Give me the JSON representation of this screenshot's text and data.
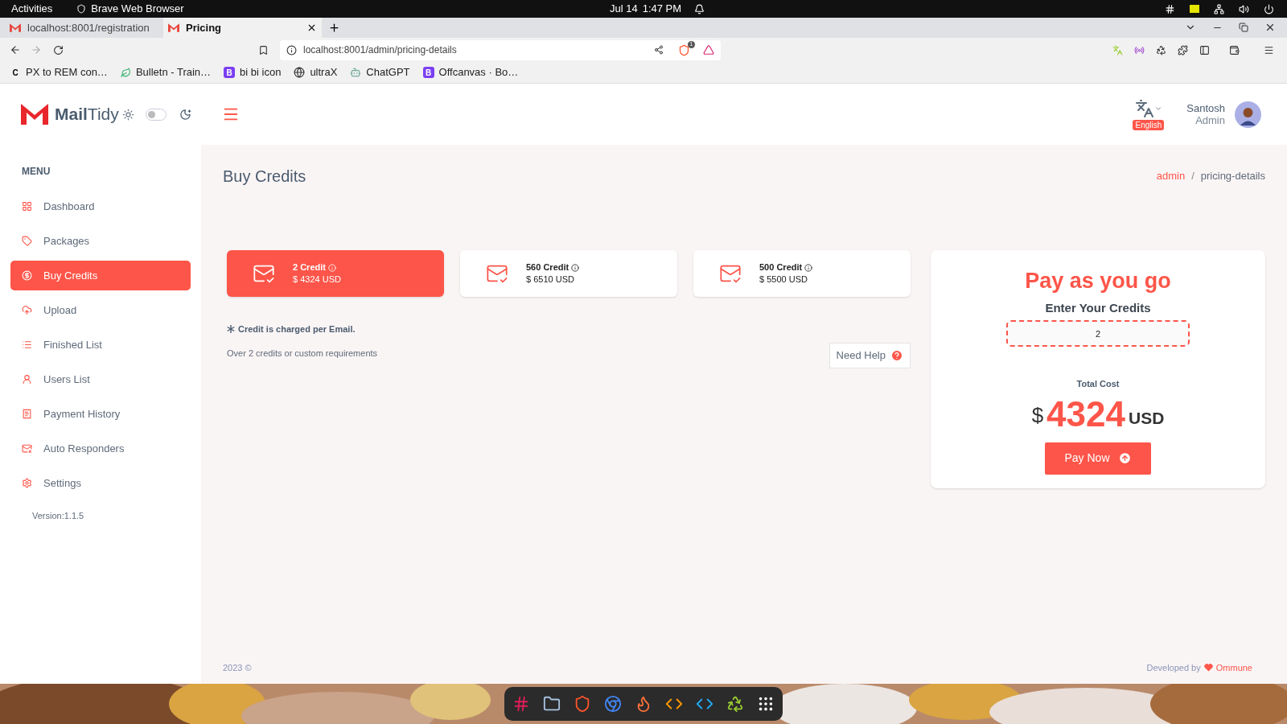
{
  "os_bar": {
    "activities": "Activities",
    "app_name": "Brave Web Browser",
    "date": "Jul 14",
    "time": "1:47 PM"
  },
  "browser": {
    "tabs": [
      {
        "title": "localhost:8001/registration",
        "selected": false
      },
      {
        "title": "Pricing",
        "selected": true
      }
    ],
    "url": "localhost:8001/admin/pricing-details",
    "shield_count": "1",
    "bookmarks": [
      {
        "label": "PX to REM con…",
        "kind": "letter",
        "glyph": "C"
      },
      {
        "label": "Bulletn - Train…",
        "kind": "leaf"
      },
      {
        "label": "bi bi icon",
        "kind": "letter",
        "glyph": "B"
      },
      {
        "label": "ultraX",
        "kind": "globe"
      },
      {
        "label": "ChatGPT",
        "kind": "bot"
      },
      {
        "label": "Offcanvas · Bo…",
        "kind": "letter",
        "glyph": "B"
      }
    ]
  },
  "header": {
    "brand_strong": "Mail",
    "brand_light": "Tidy",
    "dark_mode": false,
    "language": "English",
    "user_name": "Santosh",
    "user_role": "Admin"
  },
  "sidebar": {
    "heading": "MENU",
    "items": [
      {
        "label": "Dashboard",
        "selected": false
      },
      {
        "label": "Packages",
        "selected": false
      },
      {
        "label": "Buy Credits",
        "selected": true
      },
      {
        "label": "Upload",
        "selected": false
      },
      {
        "label": "Finished List",
        "selected": false
      },
      {
        "label": "Users List",
        "selected": false
      },
      {
        "label": "Payment History",
        "selected": false
      },
      {
        "label": "Auto Responders",
        "selected": false
      },
      {
        "label": "Settings",
        "selected": false
      }
    ],
    "version": "Version:1.1.5"
  },
  "page": {
    "title": "Buy Credits",
    "breadcrumb": [
      {
        "label": "admin",
        "link": true
      },
      {
        "label": "pricing-details",
        "link": false
      }
    ],
    "breadcrumb_separator": "/"
  },
  "packages": [
    {
      "credit": "2 Credit",
      "price": "$ 4324 USD",
      "selected": true
    },
    {
      "credit": "560 Credit",
      "price": "$ 6510 USD",
      "selected": false
    },
    {
      "credit": "500 Credit",
      "price": "$ 5500 USD",
      "selected": false
    }
  ],
  "note": "Credit is charged per Email.",
  "custom_note": "Over 2 credits or custom requirements",
  "help_button": "Need Help",
  "pay": {
    "title": "Pay as you go",
    "label": "Enter Your Credits",
    "value": "2",
    "total_label": "Total Cost",
    "currency": "$",
    "amount": "4324",
    "unit": "USD",
    "button": "Pay Now"
  },
  "footer": {
    "year": "2023 ©",
    "credit_prefix": "Developed by",
    "credit_link": "Ommune"
  }
}
